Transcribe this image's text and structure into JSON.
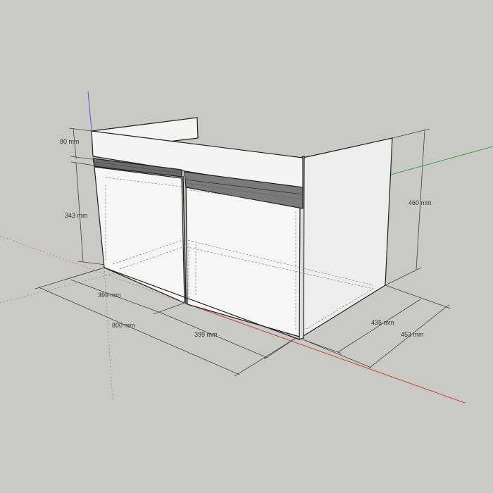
{
  "scene": {
    "background": "#c9cac5",
    "axis_colors": {
      "red": "#c0392b",
      "green": "#2ea043",
      "blue": "#2f4fd8"
    }
  },
  "dimensions": {
    "top_rail_height": "80 mm",
    "door_height": "343 mm",
    "total_height": "460 mm",
    "left_door_width": "399 mm",
    "total_width": "800 mm",
    "right_door_width": "399 mm",
    "inner_depth": "435 mm",
    "total_depth": "453 mm"
  }
}
